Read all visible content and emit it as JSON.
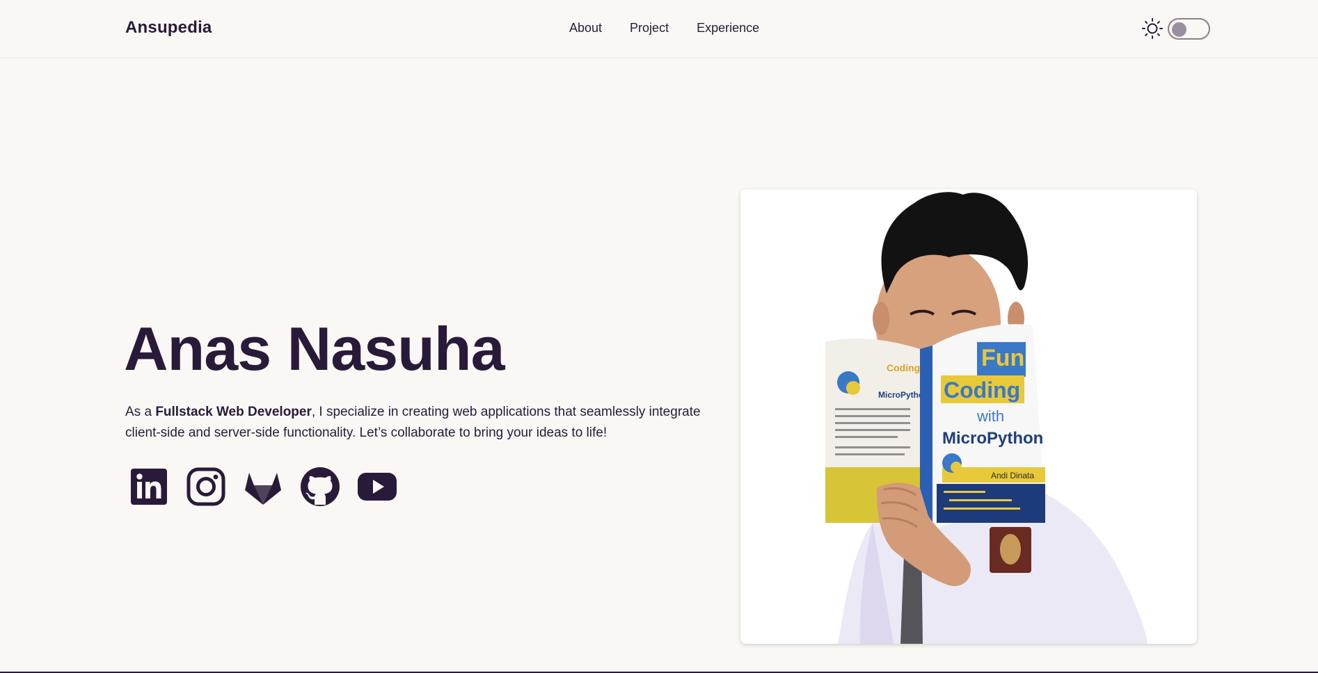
{
  "navbar": {
    "brand": "Ansupedia",
    "links": [
      "About",
      "Project",
      "Experience"
    ],
    "theme_icon": "sun-icon",
    "theme_toggle_on": false
  },
  "hero": {
    "name": "Anas Nasuha",
    "desc_prefix": "As a ",
    "desc_role": "Fullstack Web Developer",
    "desc_rest": ", I specialize in creating web applications that seamlessly integrate client-side and server-side functionality. Let’s collaborate to bring your ideas to life!",
    "socials": [
      "linkedin-icon",
      "instagram-icon",
      "gitlab-icon",
      "github-icon",
      "youtube-icon"
    ]
  },
  "photo": {
    "book_title_1": "Fun",
    "book_title_2": "Coding",
    "book_title_3": "with",
    "book_title_4": "MicroPython",
    "book_author": "Andi Dinata"
  },
  "colors": {
    "background": "#faf7f4",
    "text": "#2a1a3a",
    "accent_yellow": "#e8c93a",
    "accent_blue": "#3a78c8"
  }
}
